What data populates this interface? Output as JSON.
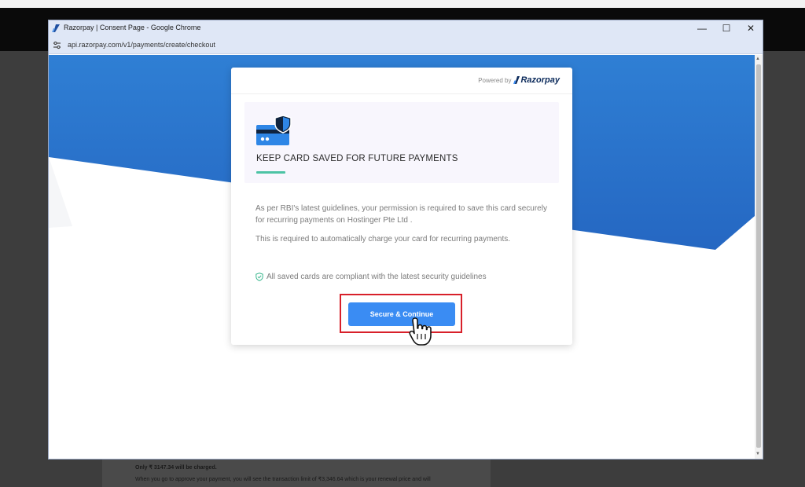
{
  "window": {
    "title": "Razorpay | Consent Page - Google Chrome",
    "url": "api.razorpay.com/v1/payments/create/checkout",
    "minimize": "—",
    "maximize": "☐",
    "close": "✕"
  },
  "card": {
    "powered_by": "Powered by",
    "brand": "Razorpay",
    "title": "KEEP CARD SAVED FOR FUTURE PAYMENTS",
    "paragraph1": "As per RBI's latest guidelines, your permission is required to save this card securely for recurring payments on Hostinger Pte Ltd .",
    "paragraph2": "This is required to automatically charge your card for recurring payments.",
    "compliance": "All saved cards are compliant with the latest security guidelines",
    "button_label": "Secure & Continue"
  },
  "background": {
    "line1": "Only ₹ 3147.34 will be charged.",
    "line2": "When you go to approve your payment, you will see the transaction limit of ₹3,346.64 which is your renewal price and will"
  },
  "colors": {
    "accent": "#3a8cf3",
    "brand_navy": "#0b2a5b",
    "highlight": "#d8202a",
    "underline": "#4cc3a4",
    "header_blue": "#2f7fd4"
  }
}
